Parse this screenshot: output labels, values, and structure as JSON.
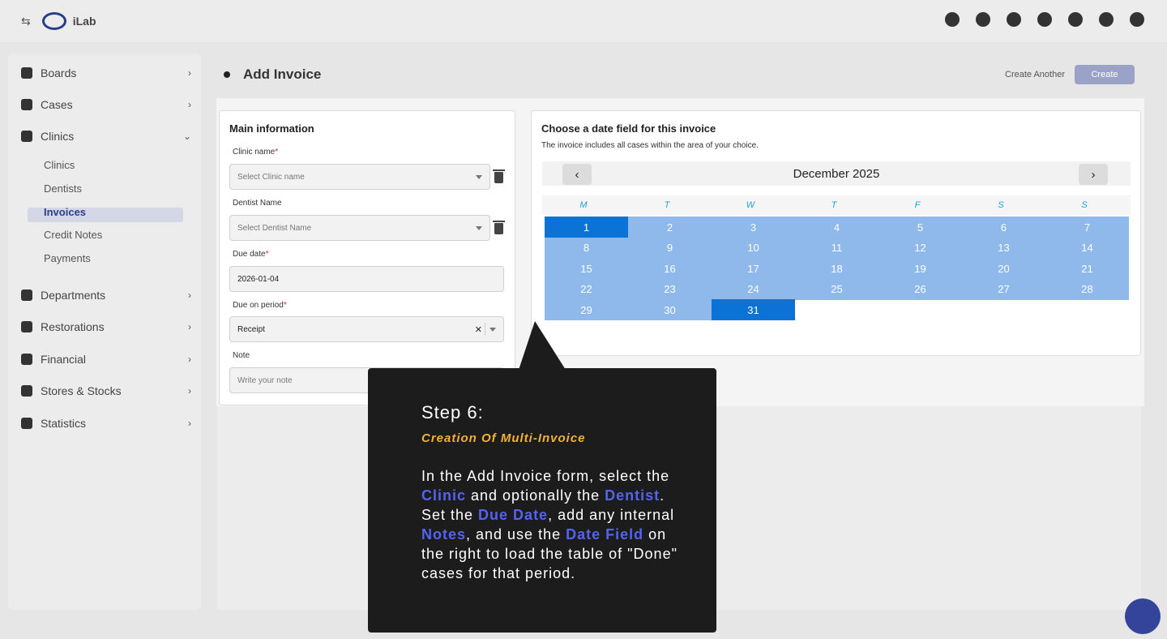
{
  "app": {
    "logo_text": "iLab"
  },
  "sidebar": {
    "items": [
      {
        "label": "Boards",
        "icon": "board-icon"
      },
      {
        "label": "Cases",
        "icon": "user-icon"
      },
      {
        "label": "Clinics",
        "icon": "clinic-icon"
      },
      {
        "label": "Departments",
        "icon": "department-icon"
      },
      {
        "label": "Restorations",
        "icon": "tooth-icon"
      },
      {
        "label": "Financial",
        "icon": "dollar-icon"
      },
      {
        "label": "Stores & Stocks",
        "icon": "store-icon"
      },
      {
        "label": "Statistics",
        "icon": "chart-icon"
      }
    ],
    "clinic_sub": [
      "Clinics",
      "Dentists",
      "Invoices",
      "Credit Notes",
      "Payments"
    ]
  },
  "header": {
    "title": "Add Invoice",
    "create_another": "Create Another",
    "create_button": "Create"
  },
  "main_info": {
    "title": "Main information",
    "clinic_label": "Clinic name",
    "clinic_placeholder": "Select Clinic name",
    "dentist_label": "Dentist Name",
    "dentist_placeholder": "Select Dentist Name",
    "due_date_label": "Due date",
    "due_date_value": "2026-01-04",
    "due_period_label": "Due on period",
    "due_period_value": "Receipt",
    "note_label": "Note",
    "note_placeholder": "Write your note",
    "required_mark": "*"
  },
  "date_field": {
    "title": "Choose a date field for this invoice",
    "subtitle": "The invoice includes all cases within the area of your choice.",
    "month": "December 2025",
    "prev": "‹",
    "next": "›",
    "weekdays": [
      "M",
      "T",
      "W",
      "T",
      "F",
      "S",
      "S"
    ],
    "days": [
      "1",
      "2",
      "3",
      "4",
      "5",
      "6",
      "7",
      "8",
      "9",
      "10",
      "11",
      "12",
      "13",
      "14",
      "15",
      "16",
      "17",
      "18",
      "19",
      "20",
      "21",
      "22",
      "23",
      "24",
      "25",
      "26",
      "27",
      "28",
      "29",
      "30",
      "31"
    ],
    "selected_start": "1",
    "selected_end": "31"
  },
  "tooltip": {
    "step": "Step 6:",
    "subtitle": "Creation Of Multi-Invoice",
    "t1": "In the Add Invoice form, select the ",
    "h1": "Clinic",
    "t2": " and optionally the ",
    "h2": "Dentist",
    "t3": ". Set the ",
    "h3": "Due Date",
    "t4": ", add any internal ",
    "h4": "Notes",
    "t5": ", and use the ",
    "h5": "Date Field",
    "t6": " on the right to load the table of \"Done\" cases for that period.",
    "highlight_color": "#5463f2",
    "subtitle_color": "#f2b233"
  }
}
